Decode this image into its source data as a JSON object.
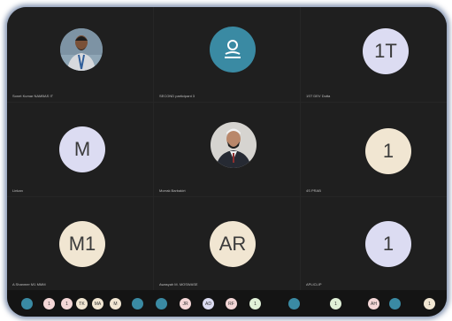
{
  "tiles": [
    {
      "kind": "photo",
      "name": "Sonet Kumar NAMBAS IT",
      "photo": "person-man-with-lanyard"
    },
    {
      "kind": "icon",
      "name": "SECOND participant 3",
      "bg": "#3a8aa3"
    },
    {
      "kind": "initials",
      "name": "1ST DEV Dutta",
      "initials": "1T",
      "bg": "#dcdcf2"
    },
    {
      "kind": "initials",
      "name": "Linkan",
      "initials": "M",
      "bg": "#dcdcf2"
    },
    {
      "kind": "photo",
      "name": "Morrak Barbakirt",
      "photo": "person-man-in-suit"
    },
    {
      "kind": "initials",
      "name": "4S PRAB",
      "initials": "1",
      "bg": "#f1e6d2"
    },
    {
      "kind": "initials",
      "name": "A Shanmer M1 MMM",
      "initials": "M1",
      "bg": "#f1e6d2"
    },
    {
      "kind": "initials",
      "name": "Awasyah M. MOSWASE",
      "initials": "AR",
      "bg": "#f1e6d2"
    },
    {
      "kind": "initials",
      "name": "APLICLIP",
      "initials": "1",
      "bg": "#dcdcf2"
    }
  ],
  "participants_bar": [
    {
      "label": "",
      "bg": "#3a8aa3"
    },
    {
      "label": "1",
      "bg": "#f4d7d7"
    },
    {
      "label": "1",
      "bg": "#f4d7d7"
    },
    {
      "label": "TK",
      "bg": "#f1e6d2"
    },
    {
      "label": "MA",
      "bg": "#f1e6d2"
    },
    {
      "label": "M",
      "bg": "#f1e6d2"
    },
    {
      "label": "",
      "bg": "#3a8aa3"
    },
    {
      "label": "",
      "bg": "#3a8aa3"
    },
    {
      "label": "JR",
      "bg": "#f4d7d7"
    },
    {
      "label": "AD",
      "bg": "#dcdcf2"
    },
    {
      "label": "RF",
      "bg": "#f4d7d7"
    },
    {
      "label": "1",
      "bg": "#e0f0d7"
    },
    {
      "label": "",
      "bg": "#3a8aa3"
    },
    {
      "label": "1",
      "bg": "#e0f0d7"
    },
    {
      "label": "AH",
      "bg": "#f4d7d7"
    },
    {
      "label": "",
      "bg": "#3a8aa3"
    },
    {
      "label": "1",
      "bg": "#f1e6d2"
    }
  ]
}
